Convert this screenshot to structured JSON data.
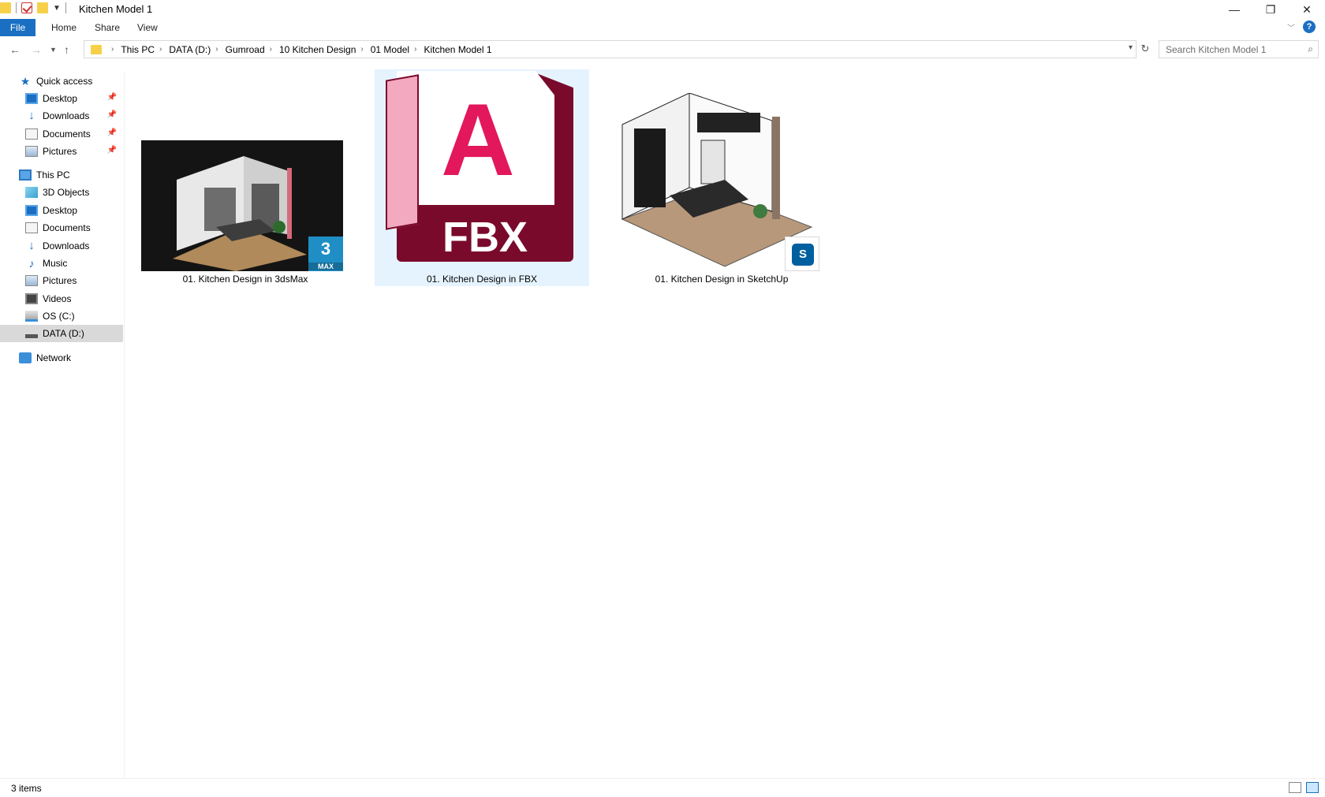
{
  "window": {
    "title": "Kitchen Model 1",
    "controls": {
      "minimize": "—",
      "restore": "❐",
      "close": "✕"
    }
  },
  "ribbon": {
    "tabs": [
      "File",
      "Home",
      "Share",
      "View"
    ],
    "help": "?"
  },
  "navigation": {
    "breadcrumbs": [
      "This PC",
      "DATA (D:)",
      "Gumroad",
      "10 Kitchen Design",
      "01 Model",
      "Kitchen Model 1"
    ],
    "search_placeholder": "Search Kitchen Model 1"
  },
  "sidebar": {
    "quick_access": "Quick access",
    "quick_items": [
      "Desktop",
      "Downloads",
      "Documents",
      "Pictures"
    ],
    "this_pc": "This PC",
    "pc_items": [
      "3D Objects",
      "Desktop",
      "Documents",
      "Downloads",
      "Music",
      "Pictures",
      "Videos",
      "OS (C:)",
      "DATA (D:)"
    ],
    "network": "Network"
  },
  "files": [
    {
      "name": "01. Kitchen Design in 3dsMax",
      "badge_number": "3",
      "badge_text": "MAX"
    },
    {
      "name": "01. Kitchen Design in FBX",
      "icon_letter": "A",
      "icon_ext": "FBX"
    },
    {
      "name": "01. Kitchen Design in SketchUp"
    }
  ],
  "status": {
    "item_count": "3 items"
  },
  "colors": {
    "accent": "#1a6fc2",
    "fbx_red": "#e3175b",
    "fbx_dark": "#7a0a2c",
    "selection": "#cce8ff"
  }
}
